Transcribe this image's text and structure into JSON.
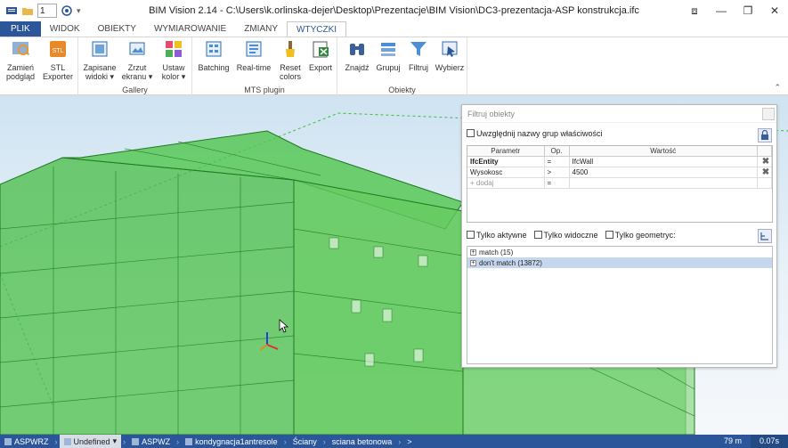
{
  "window": {
    "title": "BIM Vision 2.14 - C:\\Users\\k.orlinska-dejer\\Desktop\\Prezentacje\\BIM Vision\\DC3-prezentacja-ASP konstrukcja.ifc",
    "spinner_value": "1"
  },
  "tabs": [
    {
      "label": "PLIK"
    },
    {
      "label": "WIDOK"
    },
    {
      "label": "OBIEKTY"
    },
    {
      "label": "WYMIAROWANIE"
    },
    {
      "label": "ZMIANY"
    },
    {
      "label": "WTYCZKI"
    }
  ],
  "ribbon": {
    "buttons": [
      {
        "label": "Zamień podgląd",
        "icon": "swap-view-icon"
      },
      {
        "label": "STL Exporter",
        "icon": "stl-icon"
      },
      {
        "label": "Zapisane widoki ▾",
        "icon": "saved-views-icon"
      },
      {
        "label": "Zrzut ekranu ▾",
        "icon": "screenshot-icon"
      },
      {
        "label": "Ustaw kolor ▾",
        "icon": "color-icon"
      },
      {
        "label": "Batching",
        "icon": "batching-icon"
      },
      {
        "label": "Real-time",
        "icon": "realtime-icon"
      },
      {
        "label": "Reset colors",
        "icon": "brush-icon"
      },
      {
        "label": "Export",
        "icon": "excel-export-icon"
      },
      {
        "label": "Znajdź",
        "icon": "binoculars-icon"
      },
      {
        "label": "Grupuj",
        "icon": "group-icon"
      },
      {
        "label": "Filtruj",
        "icon": "funnel-icon"
      },
      {
        "label": "Wybierz",
        "icon": "select-icon"
      }
    ],
    "groups": [
      "Gallery",
      "MTS plugin",
      "Obiekty"
    ],
    "stl_badge": "STL"
  },
  "filter_panel": {
    "title": "Filtruj obiekty",
    "include_group_names": "Uwzględnij nazwy grup właściwości",
    "columns": [
      "Parametr",
      "Op.",
      "Wartość"
    ],
    "rows": [
      {
        "param": "IfcEntity",
        "op": "=",
        "value": "IfcWall"
      },
      {
        "param": "Wysokosc",
        "op": ">",
        "value": "4500"
      }
    ],
    "add_row": {
      "param": "+ dodaj",
      "op": "="
    },
    "options": [
      "Tylko aktywne",
      "Tylko widoczne",
      "Tylko geometryc:"
    ],
    "results": [
      {
        "label": "match  (15)"
      },
      {
        "label": "don't match  (13872)"
      }
    ]
  },
  "status": {
    "items": [
      "ASPWRZ",
      "Undefined",
      "ASPWZ",
      "kondygnacja1antresole",
      "Ściany",
      "sciana betonowa",
      ">"
    ],
    "distance": "79 m",
    "time": "0.07s"
  },
  "colors": {
    "accent": "#2b579a",
    "model_green": "#35b33a",
    "selection": "#c5d7ee"
  }
}
